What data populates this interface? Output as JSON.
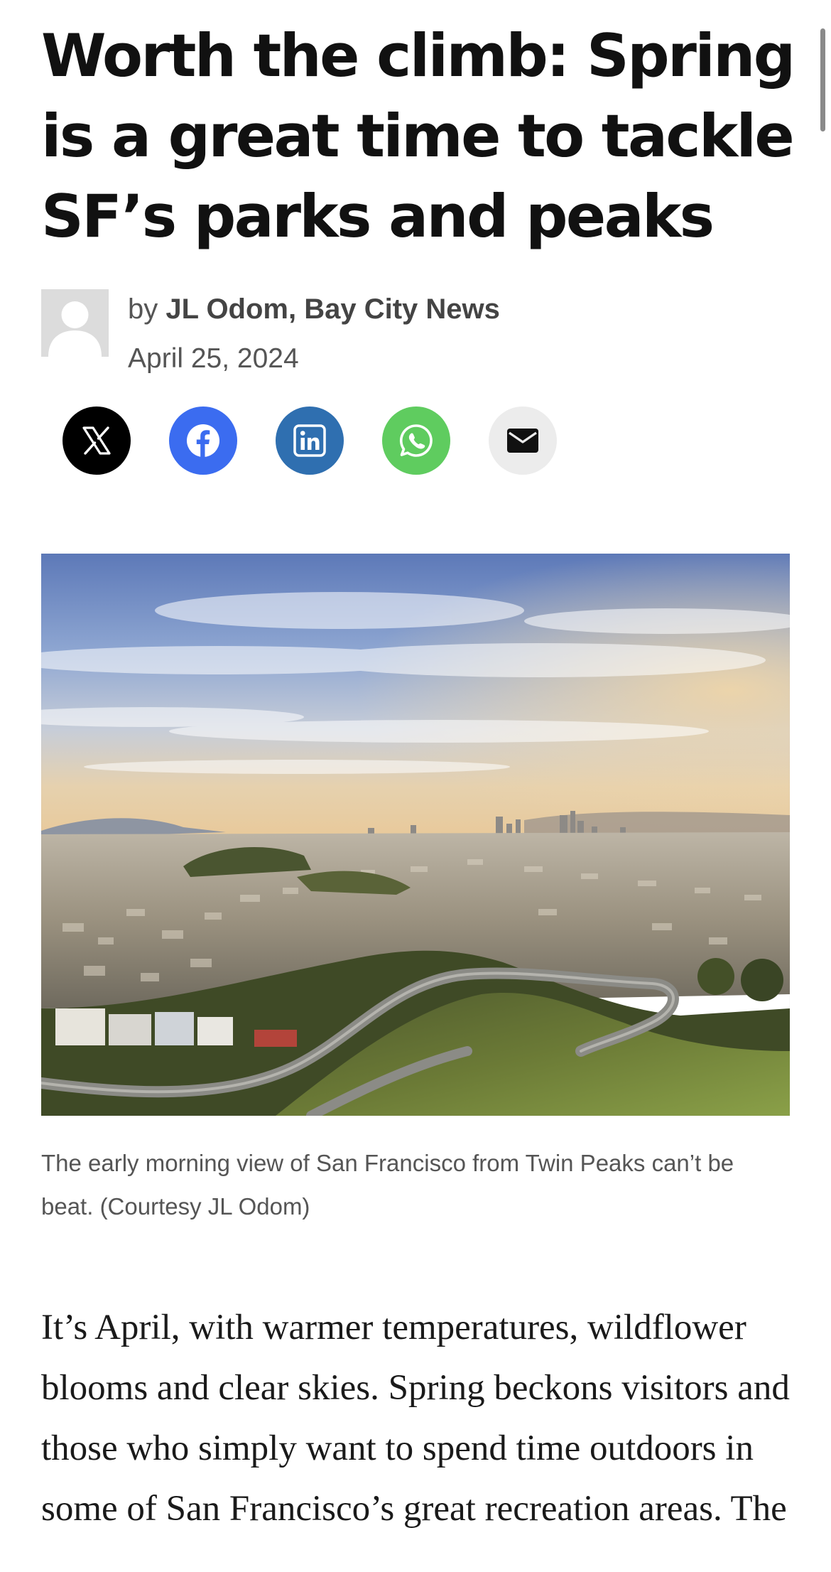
{
  "article": {
    "headline": "Worth the climb: Spring is a great time to tackle SF’s parks and peaks",
    "byline_prefix": "by",
    "author": "JL Odom, Bay City News",
    "date": "April 25, 2024",
    "image_caption": "The early morning view of San Francisco from Twin Peaks can’t be beat. (Courtesy JL Odom)",
    "body_paragraph_1": "It’s April, with warmer temperatures, wildflower blooms and clear skies. Spring beckons visitors and those who simply want to spend time outdoors in some of San Francisco’s great recreation areas. The"
  },
  "share_buttons": [
    {
      "icon": "x-icon",
      "color": "#000000"
    },
    {
      "icon": "facebook-icon",
      "color": "#3b6cf0"
    },
    {
      "icon": "linkedin-icon",
      "color": "#2f6fb0"
    },
    {
      "icon": "whatsapp-icon",
      "color": "#5fcc5f"
    },
    {
      "icon": "email-icon",
      "color": "#ececec"
    }
  ]
}
